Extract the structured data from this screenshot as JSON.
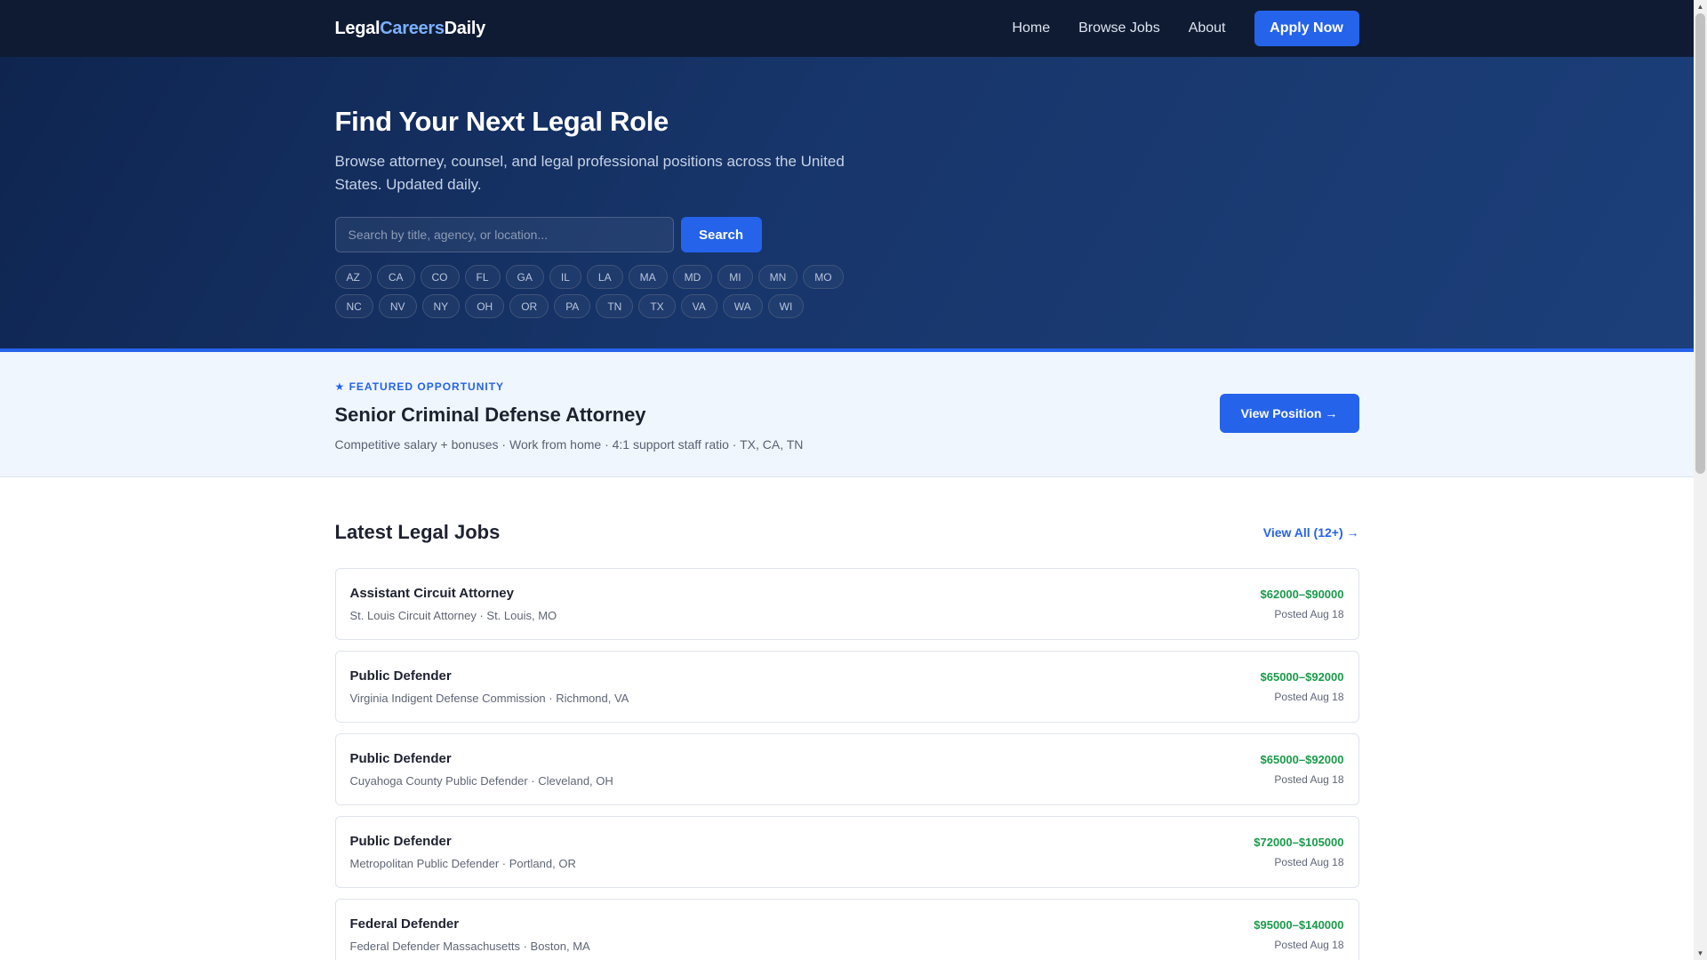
{
  "header": {
    "logo": {
      "part1": "Legal",
      "part2": "Careers",
      "part3": "Daily"
    },
    "nav": [
      {
        "label": "Home"
      },
      {
        "label": "Browse Jobs"
      },
      {
        "label": "About"
      }
    ],
    "apply_label": "Apply Now"
  },
  "hero": {
    "title": "Find Your Next Legal Role",
    "subtitle": "Browse attorney, counsel, and legal professional positions across the United States. Updated daily.",
    "search_placeholder": "Search by title, agency, or location...",
    "search_label": "Search",
    "states": [
      "AZ",
      "CA",
      "CO",
      "FL",
      "GA",
      "IL",
      "LA",
      "MA",
      "MD",
      "MI",
      "MN",
      "MO",
      "NC",
      "NV",
      "NY",
      "OH",
      "OR",
      "PA",
      "TN",
      "TX",
      "VA",
      "WA",
      "WI"
    ]
  },
  "featured": {
    "label": "★ FEATURED OPPORTUNITY",
    "title": "Senior Criminal Defense Attorney",
    "description": "Competitive salary + bonuses · Work from home · 4:1 support staff ratio · TX, CA, TN",
    "button_label": "View Position →"
  },
  "jobs": {
    "title": "Latest Legal Jobs",
    "view_all_label": "View All (12+) →",
    "items": [
      {
        "title": "Assistant Circuit Attorney",
        "meta": "St. Louis Circuit Attorney · St. Louis, MO",
        "salary": "$62000–$90000",
        "posted": "Posted Aug 18"
      },
      {
        "title": "Public Defender",
        "meta": "Virginia Indigent Defense Commission · Richmond, VA",
        "salary": "$65000–$92000",
        "posted": "Posted Aug 18"
      },
      {
        "title": "Public Defender",
        "meta": "Cuyahoga County Public Defender · Cleveland, OH",
        "salary": "$65000–$92000",
        "posted": "Posted Aug 18"
      },
      {
        "title": "Public Defender",
        "meta": "Metropolitan Public Defender · Portland, OR",
        "salary": "$72000–$105000",
        "posted": "Posted Aug 18"
      },
      {
        "title": "Federal Defender",
        "meta": "Federal Defender Massachusetts · Boston, MA",
        "salary": "$95000–$140000",
        "posted": "Posted Aug 18"
      }
    ]
  },
  "colors": {
    "header_bg": "#0f1b33",
    "accent": "#2563eb",
    "salary": "#1a9a4a",
    "featured_bg": "#eff6fd"
  }
}
